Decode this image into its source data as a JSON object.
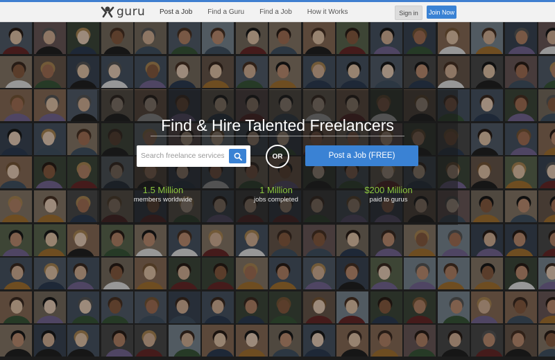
{
  "header": {
    "logo_text": "guru",
    "nav": [
      "Post a Job",
      "Find a Guru",
      "Find a Job",
      "How it Works"
    ],
    "signin_label": "Sign in",
    "join_label": "Join Now"
  },
  "hero": {
    "title": "Find & Hire Talented Freelancers",
    "search_placeholder": "Search freelance services",
    "or_label": "OR",
    "post_label": "Post a Job (FREE)",
    "stats": [
      {
        "value": "1.5 Million",
        "label": "members worldwide"
      },
      {
        "value": "1 Million",
        "label": "jobs completed"
      },
      {
        "value": "$200 Million",
        "label": "paid to gurus"
      }
    ]
  },
  "colors": {
    "accent_blue": "#3a82d4",
    "stat_green": "#8cc63f"
  }
}
